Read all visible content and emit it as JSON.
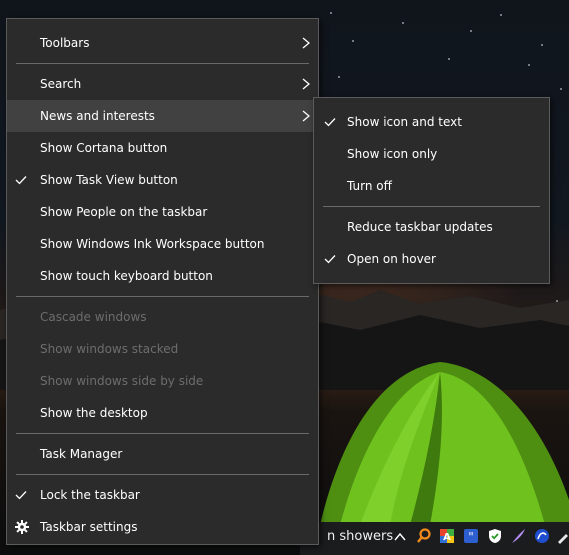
{
  "context_menu": {
    "items": [
      {
        "label": "Toolbars"
      },
      {
        "label": "Search"
      },
      {
        "label": "News and interests"
      },
      {
        "label": "Show Cortana button"
      },
      {
        "label": "Show Task View button"
      },
      {
        "label": "Show People on the taskbar"
      },
      {
        "label": "Show Windows Ink Workspace button"
      },
      {
        "label": "Show touch keyboard button"
      },
      {
        "label": "Cascade windows"
      },
      {
        "label": "Show windows stacked"
      },
      {
        "label": "Show windows side by side"
      },
      {
        "label": "Show the desktop"
      },
      {
        "label": "Task Manager"
      },
      {
        "label": "Lock the taskbar"
      },
      {
        "label": "Taskbar settings"
      }
    ]
  },
  "submenu": {
    "items": [
      {
        "label": "Show icon and text"
      },
      {
        "label": "Show icon only"
      },
      {
        "label": "Turn off"
      },
      {
        "label": "Reduce taskbar updates"
      },
      {
        "label": "Open on hover"
      }
    ]
  },
  "taskbar": {
    "weather_text": "n showers"
  },
  "colors": {
    "menu_background": "#2b2b2b",
    "menu_border": "#5b5b5b",
    "highlight": "#414141",
    "disabled_text": "#6d6d6d",
    "tent_green": "#6fc21e",
    "taskbar": "#1b1c1e"
  },
  "icons": {
    "check": "checkmark-icon",
    "submenu_arrow": "chevron-right-icon",
    "settings": "gear-icon",
    "tray_expand": "chevron-up-icon"
  }
}
